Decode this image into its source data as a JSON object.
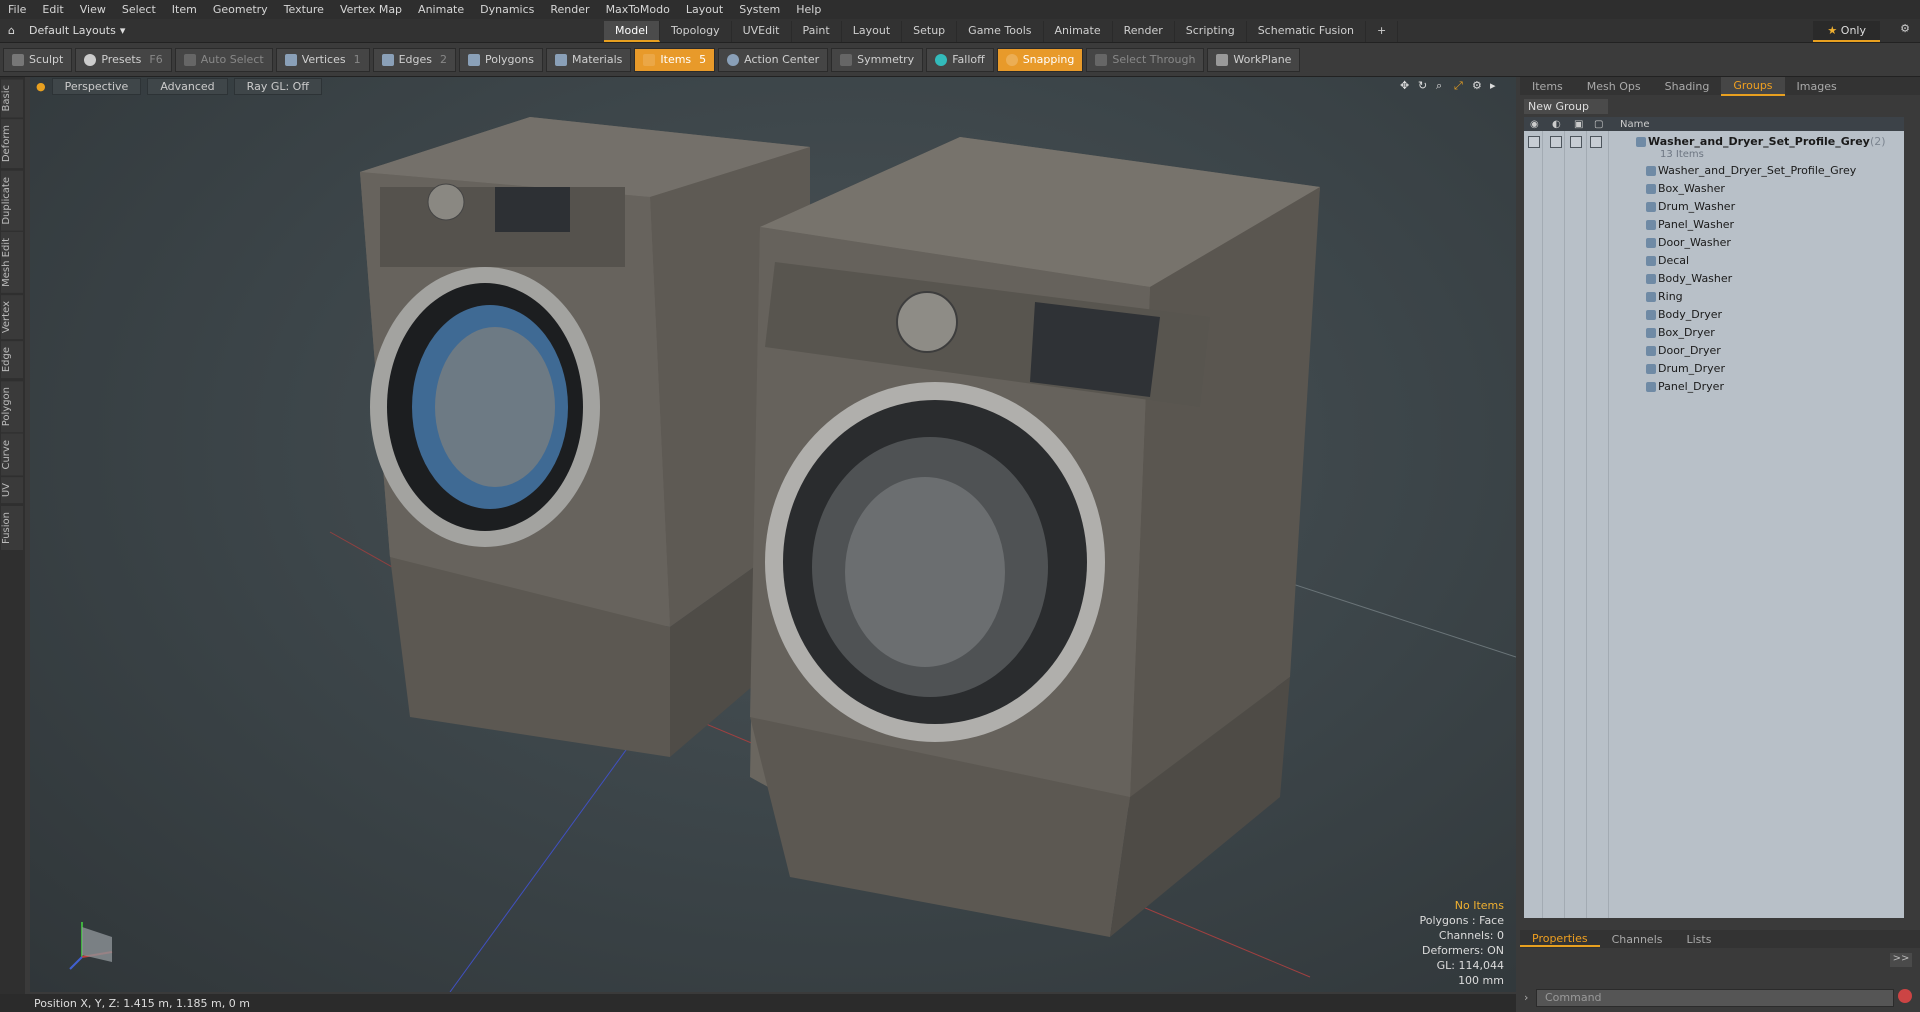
{
  "menu": [
    "File",
    "Edit",
    "View",
    "Select",
    "Item",
    "Geometry",
    "Texture",
    "Vertex Map",
    "Animate",
    "Dynamics",
    "Render",
    "MaxToModo",
    "Layout",
    "System",
    "Help"
  ],
  "layouts_label": "Default Layouts",
  "mode_tabs": [
    "Model",
    "Topology",
    "UVEdit",
    "Paint",
    "Layout",
    "Setup",
    "Game Tools",
    "Animate",
    "Render",
    "Scripting",
    "Schematic Fusion"
  ],
  "active_mode_tab": "Model",
  "only_label": "Only",
  "toolbar": {
    "sculpt": "Sculpt",
    "presets": "Presets",
    "presets_key": "F6",
    "auto_select": "Auto Select",
    "vertices": "Vertices",
    "vertices_num": "1",
    "edges": "Edges",
    "edges_num": "2",
    "polygons": "Polygons",
    "materials": "Materials",
    "items": "Items",
    "items_num": "5",
    "action_center": "Action Center",
    "symmetry": "Symmetry",
    "falloff": "Falloff",
    "snapping": "Snapping",
    "select_through": "Select Through",
    "workplane": "WorkPlane"
  },
  "left_tabs": [
    "Basic",
    "Deform",
    "Duplicate",
    "Mesh Edit",
    "Vertex",
    "Edge",
    "Polygon",
    "Curve",
    "UV",
    "Fusion"
  ],
  "viewport": {
    "view": "Perspective",
    "shading": "Advanced",
    "raygl": "Ray GL: Off",
    "stats": {
      "items": "No Items",
      "polygons": "Polygons : Face",
      "channels": "Channels: 0",
      "deformers": "Deformers: ON",
      "gl": "GL: 114,044",
      "scale": "100 mm"
    }
  },
  "status": "Position X, Y, Z:   1.415 m, 1.185 m, 0 m",
  "right_panel": {
    "tabs": [
      "Items",
      "Mesh Ops",
      "Shading",
      "Groups",
      "Images"
    ],
    "active_tab": "Groups",
    "new_group": "New Group",
    "col_name": "Name",
    "root": "Washer_and_Dryer_Set_Profile_Grey",
    "root_count": "(2)",
    "sub": "13 Items",
    "locator": "Washer_and_Dryer_Set_Profile_Grey",
    "items": [
      "Box_Washer",
      "Drum_Washer",
      "Panel_Washer",
      "Door_Washer",
      "Decal",
      "Body_Washer",
      "Ring",
      "Body_Dryer",
      "Box_Dryer",
      "Door_Dryer",
      "Drum_Dryer",
      "Panel_Dryer"
    ],
    "bottom_tabs": [
      "Properties",
      "Channels",
      "Lists"
    ],
    "active_bottom_tab": "Properties",
    "command_placeholder": "Command"
  }
}
